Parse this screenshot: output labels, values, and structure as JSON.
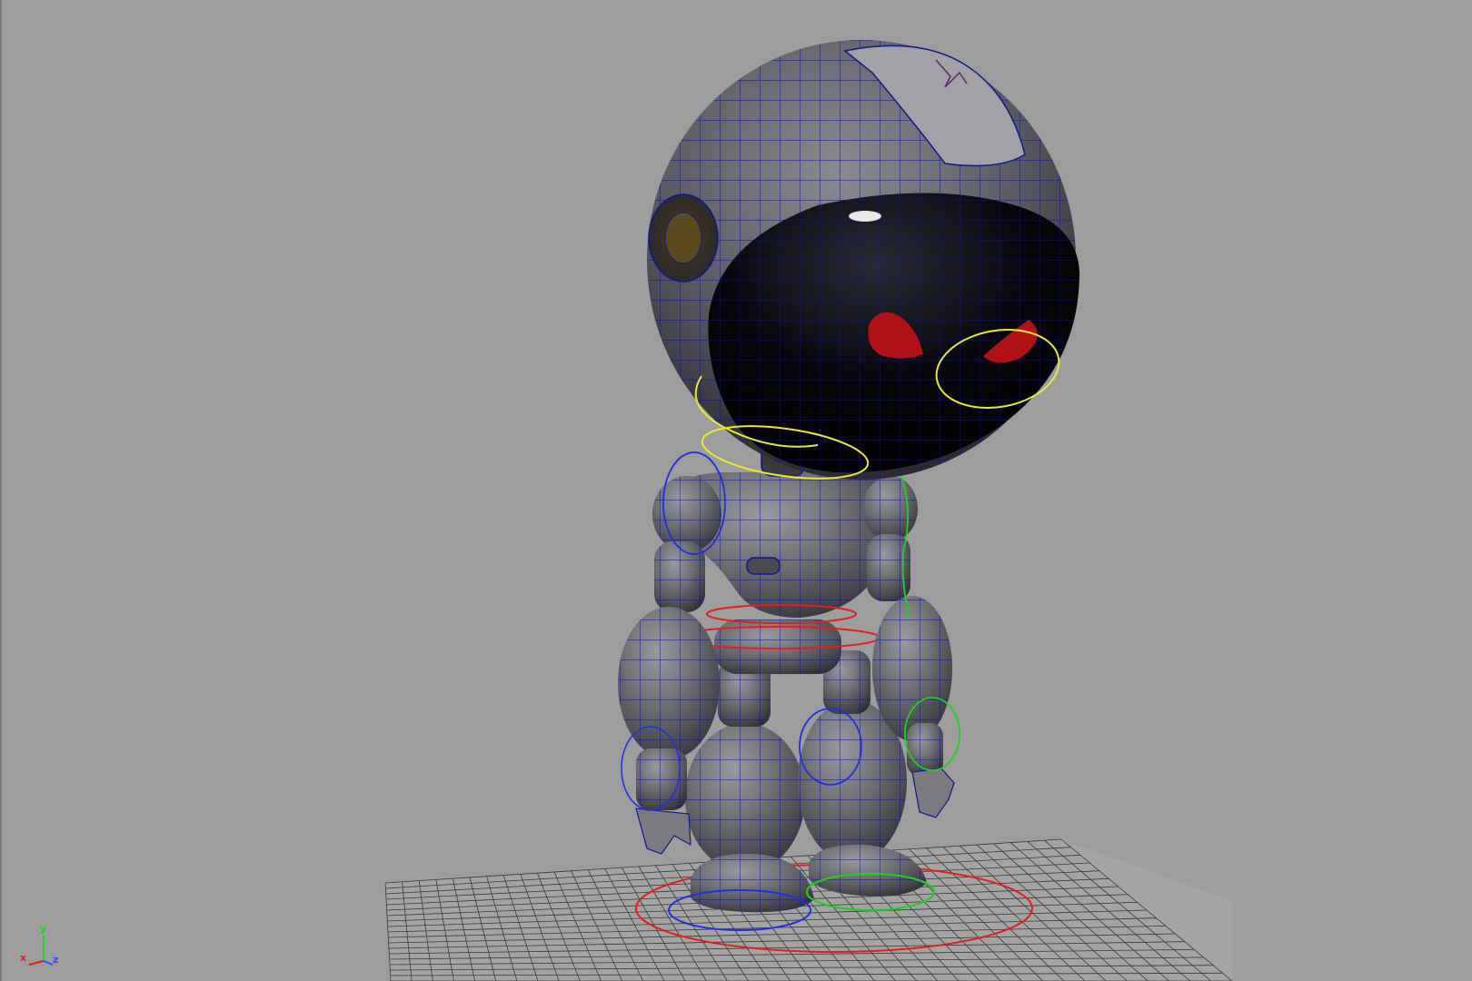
{
  "viewport": {
    "title": "",
    "background": "#9d9d9d"
  },
  "axis_gizmo": {
    "x_label": "x",
    "y_label": "y",
    "z_label": "z",
    "x_color": "#e02020",
    "y_color": "#20d020",
    "z_color": "#3050ff"
  },
  "model": {
    "name": "robot-character",
    "wireframe_color": "#101a8c",
    "body_color": "#6a6a6e",
    "visor_color": "#050508",
    "eye_color": "#b01018"
  },
  "controls": {
    "neck_color": "#e8e830",
    "waist_color": "#e02020",
    "left_side_color": "#2030e0",
    "right_side_color": "#20d020",
    "root_color": "#e02020"
  },
  "ground_grid": {
    "visible": true,
    "color": "#3a3a3a"
  }
}
